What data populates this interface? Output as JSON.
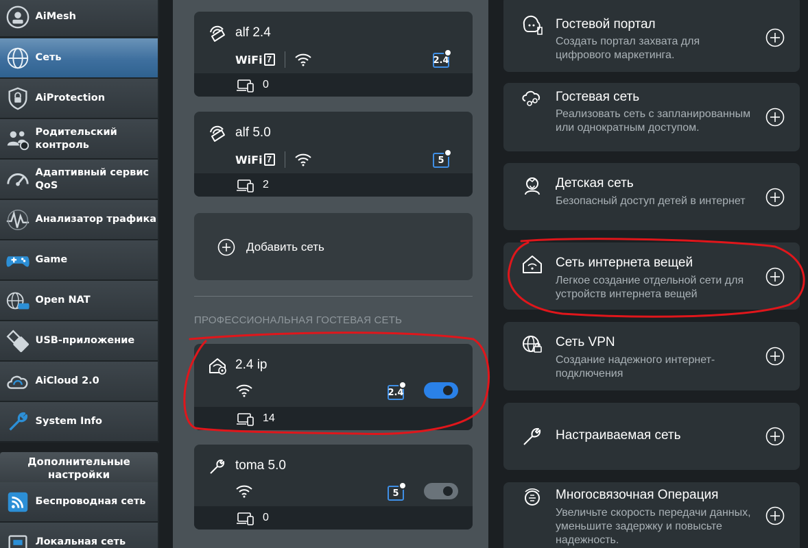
{
  "sidebar": {
    "items": [
      {
        "label": "AiMesh",
        "icon": "aimesh-icon"
      },
      {
        "label": "Сеть",
        "icon": "network-icon"
      },
      {
        "label": "AiProtection",
        "icon": "shield-icon"
      },
      {
        "label": "Родительский контроль",
        "icon": "parental-control-icon"
      },
      {
        "label": "Адаптивный сервис QoS",
        "icon": "qos-gauge-icon"
      },
      {
        "label": "Анализатор трафика",
        "icon": "traffic-analyzer-icon"
      },
      {
        "label": "Game",
        "icon": "gamepad-icon"
      },
      {
        "label": "Open NAT",
        "icon": "open-nat-icon"
      },
      {
        "label": "USB-приложение",
        "icon": "usb-icon"
      },
      {
        "label": "AiCloud 2.0",
        "icon": "cloud-icon"
      },
      {
        "label": "System Info",
        "icon": "wrench-icon"
      }
    ],
    "advanced_header": "Дополнительные настройки",
    "advanced_items": [
      {
        "label": "Беспроводная сеть",
        "icon": "wireless-icon"
      },
      {
        "label": "Локальная сеть",
        "icon": "lan-icon"
      }
    ]
  },
  "networks": [
    {
      "name": "alf 2.4",
      "wifi_label": "WiFi",
      "wifi_gen": "7",
      "band": "2.4",
      "devices": "0"
    },
    {
      "name": "alf 5.0",
      "wifi_label": "WiFi",
      "wifi_gen": "7",
      "band": "5",
      "devices": "2"
    }
  ],
  "add_network": {
    "label": "Добавить сеть"
  },
  "pro_guest": {
    "section_title": "ПРОФЕССИОНАЛЬНАЯ ГОСТЕВАЯ СЕТЬ",
    "items": [
      {
        "name": "2.4 ip",
        "band": "2.4",
        "devices": "14",
        "enabled": true
      },
      {
        "name": "toma 5.0",
        "band": "5",
        "devices": "0",
        "enabled": false
      }
    ]
  },
  "options": [
    {
      "title": "Гостевой портал",
      "desc": "Создать портал захвата для цифрового маркетинга.",
      "icon": "guest-portal-icon"
    },
    {
      "title": "Гостевая сеть",
      "desc": "Реализовать сеть с запланированным или однократным доступом.",
      "icon": "guest-network-icon"
    },
    {
      "title": "Детская сеть",
      "desc": "Безопасный доступ детей в интернет",
      "icon": "kid-icon"
    },
    {
      "title": "Сеть интернета вещей",
      "desc": "Легкое создание отдельной сети для устройств интернета вещей",
      "icon": "iot-home-icon"
    },
    {
      "title": "Сеть VPN",
      "desc": "Создание надежного интернет-подключения",
      "icon": "vpn-globe-icon"
    },
    {
      "title": "Настраиваемая сеть",
      "desc": "",
      "icon": "wrench-icon"
    },
    {
      "title": "Многосвязочная Операция",
      "desc": "Увеличьте скорость передачи данных, уменьшите задержку и повысьте надежность.",
      "icon": "multilink-icon"
    }
  ],
  "colors": {
    "accent": "#2a81e8",
    "annotation": "#e0161b",
    "active_nav": "#3e6f9e"
  }
}
